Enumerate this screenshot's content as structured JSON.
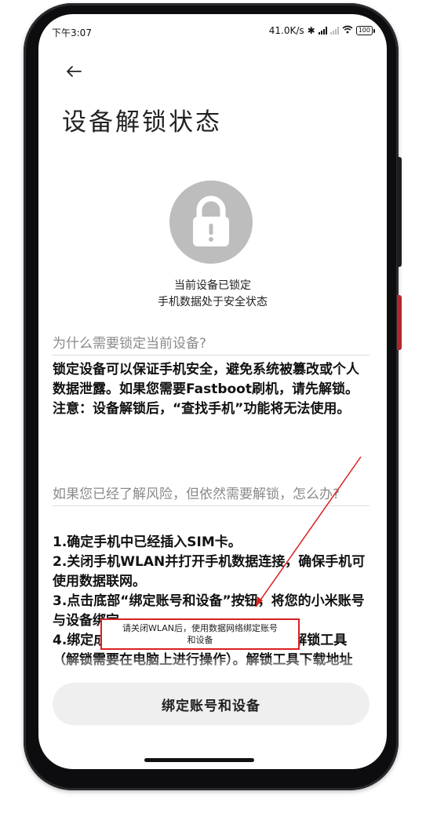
{
  "status_bar": {
    "time": "下午3:07",
    "net_speed": "41.0K/s",
    "battery": "100"
  },
  "header": {
    "title": "设备解锁状态"
  },
  "lock_status": {
    "line1": "当前设备已锁定",
    "line2": "手机数据处于安全状态"
  },
  "section1": {
    "heading": "为什么需要锁定当前设备?",
    "paragraph1": "锁定设备可以保证手机安全，避免系统被篡改或个人数据泄露。如果您需要Fastboot刷机，请先解锁。",
    "paragraph2": "注意：设备解锁后，“查找手机”功能将无法使用。"
  },
  "section2": {
    "heading": "如果您已经了解风险，但依然需要解锁，怎么办?",
    "step1": "1.确定手机中已经插入SIM卡。",
    "step2": "2.关闭手机WLAN并打开手机数据连接，确保手机可使用数据联网。",
    "step3": "3.点击底部“绑定账号和设备”按钮，将您的小米账号与设备绑定。",
    "step4": "4.绑定成功后，请访问小米解锁官网获取解锁工具（解锁需要在电脑上进行操作）。解锁工具下载地址"
  },
  "toast": {
    "line1": "请关闭WLAN后，使用数据网络绑定账号",
    "line2": "和设备"
  },
  "actions": {
    "bind_button": "绑定账号和设备"
  },
  "colors": {
    "accent_annotation": "#d92020",
    "icon_gray": "#bdbdbd"
  }
}
